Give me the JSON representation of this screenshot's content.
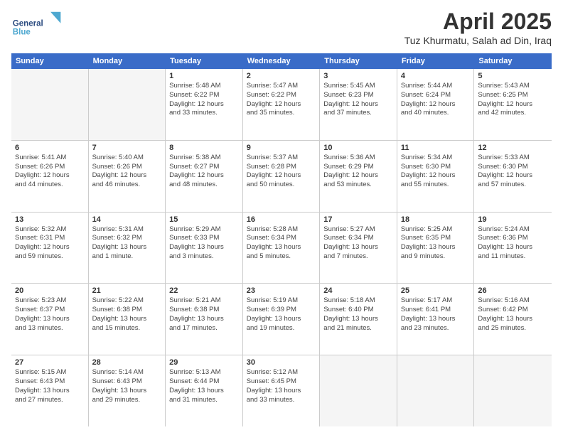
{
  "header": {
    "title": "April 2025",
    "subtitle": "Tuz Khurmatu, Salah ad Din, Iraq",
    "logo_line1": "General",
    "logo_line2": "Blue"
  },
  "days_of_week": [
    "Sunday",
    "Monday",
    "Tuesday",
    "Wednesday",
    "Thursday",
    "Friday",
    "Saturday"
  ],
  "weeks": [
    [
      {
        "day": "",
        "info": ""
      },
      {
        "day": "",
        "info": ""
      },
      {
        "day": "1",
        "info": "Sunrise: 5:48 AM\nSunset: 6:22 PM\nDaylight: 12 hours\nand 33 minutes."
      },
      {
        "day": "2",
        "info": "Sunrise: 5:47 AM\nSunset: 6:22 PM\nDaylight: 12 hours\nand 35 minutes."
      },
      {
        "day": "3",
        "info": "Sunrise: 5:45 AM\nSunset: 6:23 PM\nDaylight: 12 hours\nand 37 minutes."
      },
      {
        "day": "4",
        "info": "Sunrise: 5:44 AM\nSunset: 6:24 PM\nDaylight: 12 hours\nand 40 minutes."
      },
      {
        "day": "5",
        "info": "Sunrise: 5:43 AM\nSunset: 6:25 PM\nDaylight: 12 hours\nand 42 minutes."
      }
    ],
    [
      {
        "day": "6",
        "info": "Sunrise: 5:41 AM\nSunset: 6:26 PM\nDaylight: 12 hours\nand 44 minutes."
      },
      {
        "day": "7",
        "info": "Sunrise: 5:40 AM\nSunset: 6:26 PM\nDaylight: 12 hours\nand 46 minutes."
      },
      {
        "day": "8",
        "info": "Sunrise: 5:38 AM\nSunset: 6:27 PM\nDaylight: 12 hours\nand 48 minutes."
      },
      {
        "day": "9",
        "info": "Sunrise: 5:37 AM\nSunset: 6:28 PM\nDaylight: 12 hours\nand 50 minutes."
      },
      {
        "day": "10",
        "info": "Sunrise: 5:36 AM\nSunset: 6:29 PM\nDaylight: 12 hours\nand 53 minutes."
      },
      {
        "day": "11",
        "info": "Sunrise: 5:34 AM\nSunset: 6:30 PM\nDaylight: 12 hours\nand 55 minutes."
      },
      {
        "day": "12",
        "info": "Sunrise: 5:33 AM\nSunset: 6:30 PM\nDaylight: 12 hours\nand 57 minutes."
      }
    ],
    [
      {
        "day": "13",
        "info": "Sunrise: 5:32 AM\nSunset: 6:31 PM\nDaylight: 12 hours\nand 59 minutes."
      },
      {
        "day": "14",
        "info": "Sunrise: 5:31 AM\nSunset: 6:32 PM\nDaylight: 13 hours\nand 1 minute."
      },
      {
        "day": "15",
        "info": "Sunrise: 5:29 AM\nSunset: 6:33 PM\nDaylight: 13 hours\nand 3 minutes."
      },
      {
        "day": "16",
        "info": "Sunrise: 5:28 AM\nSunset: 6:34 PM\nDaylight: 13 hours\nand 5 minutes."
      },
      {
        "day": "17",
        "info": "Sunrise: 5:27 AM\nSunset: 6:34 PM\nDaylight: 13 hours\nand 7 minutes."
      },
      {
        "day": "18",
        "info": "Sunrise: 5:25 AM\nSunset: 6:35 PM\nDaylight: 13 hours\nand 9 minutes."
      },
      {
        "day": "19",
        "info": "Sunrise: 5:24 AM\nSunset: 6:36 PM\nDaylight: 13 hours\nand 11 minutes."
      }
    ],
    [
      {
        "day": "20",
        "info": "Sunrise: 5:23 AM\nSunset: 6:37 PM\nDaylight: 13 hours\nand 13 minutes."
      },
      {
        "day": "21",
        "info": "Sunrise: 5:22 AM\nSunset: 6:38 PM\nDaylight: 13 hours\nand 15 minutes."
      },
      {
        "day": "22",
        "info": "Sunrise: 5:21 AM\nSunset: 6:38 PM\nDaylight: 13 hours\nand 17 minutes."
      },
      {
        "day": "23",
        "info": "Sunrise: 5:19 AM\nSunset: 6:39 PM\nDaylight: 13 hours\nand 19 minutes."
      },
      {
        "day": "24",
        "info": "Sunrise: 5:18 AM\nSunset: 6:40 PM\nDaylight: 13 hours\nand 21 minutes."
      },
      {
        "day": "25",
        "info": "Sunrise: 5:17 AM\nSunset: 6:41 PM\nDaylight: 13 hours\nand 23 minutes."
      },
      {
        "day": "26",
        "info": "Sunrise: 5:16 AM\nSunset: 6:42 PM\nDaylight: 13 hours\nand 25 minutes."
      }
    ],
    [
      {
        "day": "27",
        "info": "Sunrise: 5:15 AM\nSunset: 6:43 PM\nDaylight: 13 hours\nand 27 minutes."
      },
      {
        "day": "28",
        "info": "Sunrise: 5:14 AM\nSunset: 6:43 PM\nDaylight: 13 hours\nand 29 minutes."
      },
      {
        "day": "29",
        "info": "Sunrise: 5:13 AM\nSunset: 6:44 PM\nDaylight: 13 hours\nand 31 minutes."
      },
      {
        "day": "30",
        "info": "Sunrise: 5:12 AM\nSunset: 6:45 PM\nDaylight: 13 hours\nand 33 minutes."
      },
      {
        "day": "",
        "info": ""
      },
      {
        "day": "",
        "info": ""
      },
      {
        "day": "",
        "info": ""
      }
    ]
  ]
}
